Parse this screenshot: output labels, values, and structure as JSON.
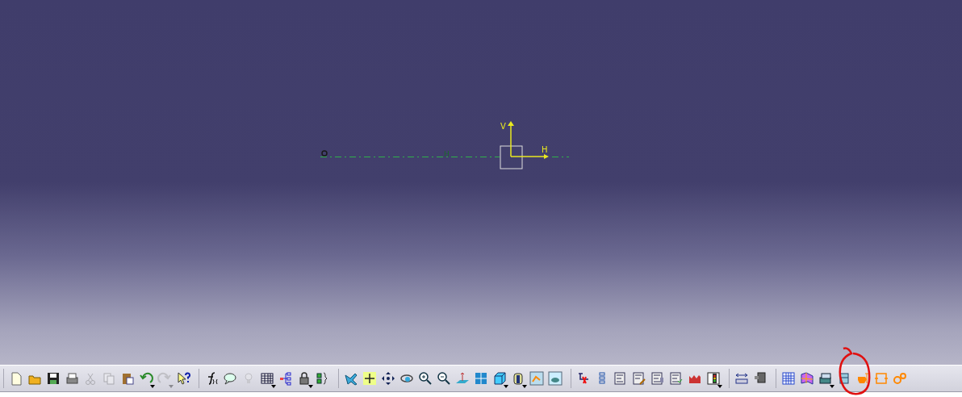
{
  "sketch": {
    "axis_labels": [
      "V",
      "H"
    ],
    "constraint_symbol": "H"
  },
  "toolbar": {
    "groups": [
      {
        "items": [
          {
            "disabled": false,
            "has_menu": false
          },
          {
            "disabled": false,
            "has_menu": false
          },
          {
            "disabled": false,
            "has_menu": false
          },
          {
            "disabled": false,
            "has_menu": false
          },
          {
            "disabled": true,
            "has_menu": false
          },
          {
            "disabled": true,
            "has_menu": false
          },
          {
            "disabled": false,
            "has_menu": false
          },
          {
            "disabled": false,
            "has_menu": true
          },
          {
            "disabled": true,
            "has_menu": true
          },
          {
            "disabled": false,
            "has_menu": false
          }
        ]
      },
      {
        "items": [
          {
            "disabled": false,
            "has_menu": false
          },
          {
            "disabled": false,
            "has_menu": false
          },
          {
            "disabled": true,
            "has_menu": false
          },
          {
            "disabled": false,
            "has_menu": true
          },
          {
            "disabled": false,
            "has_menu": false
          },
          {
            "disabled": false,
            "has_menu": true
          },
          {
            "disabled": false,
            "has_menu": false
          }
        ]
      },
      {
        "items": [
          {
            "disabled": false,
            "has_menu": false
          },
          {
            "disabled": false,
            "has_menu": false
          },
          {
            "disabled": false,
            "has_menu": false
          },
          {
            "disabled": false,
            "has_menu": false
          },
          {
            "disabled": false,
            "has_menu": false
          },
          {
            "disabled": false,
            "has_menu": false
          },
          {
            "disabled": false,
            "has_menu": false
          },
          {
            "disabled": false,
            "has_menu": false
          },
          {
            "disabled": false,
            "has_menu": true
          },
          {
            "disabled": false,
            "has_menu": true
          },
          {
            "disabled": false,
            "has_menu": false
          },
          {
            "disabled": false,
            "has_menu": false
          }
        ]
      },
      {
        "items": [
          {
            "disabled": false,
            "has_menu": false
          },
          {
            "disabled": false,
            "has_menu": false
          },
          {
            "disabled": false,
            "has_menu": false
          },
          {
            "disabled": false,
            "has_menu": false
          },
          {
            "disabled": false,
            "has_menu": false
          },
          {
            "disabled": false,
            "has_menu": false
          },
          {
            "disabled": false,
            "has_menu": false
          },
          {
            "disabled": false,
            "has_menu": true
          }
        ]
      },
      {
        "items": [
          {
            "disabled": false,
            "has_menu": false
          },
          {
            "disabled": false,
            "has_menu": false
          }
        ]
      },
      {
        "items": [
          {
            "disabled": false,
            "has_menu": false
          },
          {
            "disabled": false,
            "has_menu": false
          },
          {
            "disabled": false,
            "has_menu": true
          },
          {
            "disabled": false,
            "has_menu": false
          },
          {
            "disabled": false,
            "has_menu": false
          },
          {
            "disabled": false,
            "has_menu": false
          },
          {
            "disabled": false,
            "has_menu": false
          }
        ]
      }
    ]
  }
}
